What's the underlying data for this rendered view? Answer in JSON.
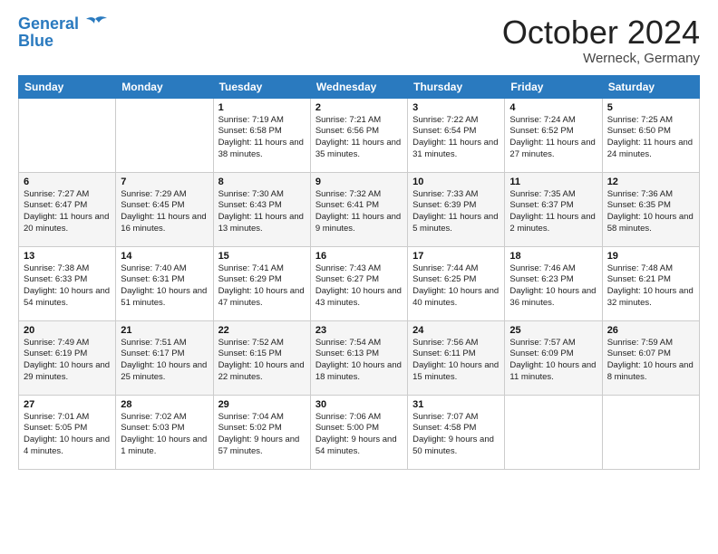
{
  "header": {
    "logo_line1": "General",
    "logo_line2": "Blue",
    "title": "October 2024",
    "location": "Werneck, Germany"
  },
  "days_of_week": [
    "Sunday",
    "Monday",
    "Tuesday",
    "Wednesday",
    "Thursday",
    "Friday",
    "Saturday"
  ],
  "weeks": [
    [
      {
        "day": "",
        "info": ""
      },
      {
        "day": "",
        "info": ""
      },
      {
        "day": "1",
        "sunrise": "Sunrise: 7:19 AM",
        "sunset": "Sunset: 6:58 PM",
        "daylight": "Daylight: 11 hours and 38 minutes."
      },
      {
        "day": "2",
        "sunrise": "Sunrise: 7:21 AM",
        "sunset": "Sunset: 6:56 PM",
        "daylight": "Daylight: 11 hours and 35 minutes."
      },
      {
        "day": "3",
        "sunrise": "Sunrise: 7:22 AM",
        "sunset": "Sunset: 6:54 PM",
        "daylight": "Daylight: 11 hours and 31 minutes."
      },
      {
        "day": "4",
        "sunrise": "Sunrise: 7:24 AM",
        "sunset": "Sunset: 6:52 PM",
        "daylight": "Daylight: 11 hours and 27 minutes."
      },
      {
        "day": "5",
        "sunrise": "Sunrise: 7:25 AM",
        "sunset": "Sunset: 6:50 PM",
        "daylight": "Daylight: 11 hours and 24 minutes."
      }
    ],
    [
      {
        "day": "6",
        "sunrise": "Sunrise: 7:27 AM",
        "sunset": "Sunset: 6:47 PM",
        "daylight": "Daylight: 11 hours and 20 minutes."
      },
      {
        "day": "7",
        "sunrise": "Sunrise: 7:29 AM",
        "sunset": "Sunset: 6:45 PM",
        "daylight": "Daylight: 11 hours and 16 minutes."
      },
      {
        "day": "8",
        "sunrise": "Sunrise: 7:30 AM",
        "sunset": "Sunset: 6:43 PM",
        "daylight": "Daylight: 11 hours and 13 minutes."
      },
      {
        "day": "9",
        "sunrise": "Sunrise: 7:32 AM",
        "sunset": "Sunset: 6:41 PM",
        "daylight": "Daylight: 11 hours and 9 minutes."
      },
      {
        "day": "10",
        "sunrise": "Sunrise: 7:33 AM",
        "sunset": "Sunset: 6:39 PM",
        "daylight": "Daylight: 11 hours and 5 minutes."
      },
      {
        "day": "11",
        "sunrise": "Sunrise: 7:35 AM",
        "sunset": "Sunset: 6:37 PM",
        "daylight": "Daylight: 11 hours and 2 minutes."
      },
      {
        "day": "12",
        "sunrise": "Sunrise: 7:36 AM",
        "sunset": "Sunset: 6:35 PM",
        "daylight": "Daylight: 10 hours and 58 minutes."
      }
    ],
    [
      {
        "day": "13",
        "sunrise": "Sunrise: 7:38 AM",
        "sunset": "Sunset: 6:33 PM",
        "daylight": "Daylight: 10 hours and 54 minutes."
      },
      {
        "day": "14",
        "sunrise": "Sunrise: 7:40 AM",
        "sunset": "Sunset: 6:31 PM",
        "daylight": "Daylight: 10 hours and 51 minutes."
      },
      {
        "day": "15",
        "sunrise": "Sunrise: 7:41 AM",
        "sunset": "Sunset: 6:29 PM",
        "daylight": "Daylight: 10 hours and 47 minutes."
      },
      {
        "day": "16",
        "sunrise": "Sunrise: 7:43 AM",
        "sunset": "Sunset: 6:27 PM",
        "daylight": "Daylight: 10 hours and 43 minutes."
      },
      {
        "day": "17",
        "sunrise": "Sunrise: 7:44 AM",
        "sunset": "Sunset: 6:25 PM",
        "daylight": "Daylight: 10 hours and 40 minutes."
      },
      {
        "day": "18",
        "sunrise": "Sunrise: 7:46 AM",
        "sunset": "Sunset: 6:23 PM",
        "daylight": "Daylight: 10 hours and 36 minutes."
      },
      {
        "day": "19",
        "sunrise": "Sunrise: 7:48 AM",
        "sunset": "Sunset: 6:21 PM",
        "daylight": "Daylight: 10 hours and 32 minutes."
      }
    ],
    [
      {
        "day": "20",
        "sunrise": "Sunrise: 7:49 AM",
        "sunset": "Sunset: 6:19 PM",
        "daylight": "Daylight: 10 hours and 29 minutes."
      },
      {
        "day": "21",
        "sunrise": "Sunrise: 7:51 AM",
        "sunset": "Sunset: 6:17 PM",
        "daylight": "Daylight: 10 hours and 25 minutes."
      },
      {
        "day": "22",
        "sunrise": "Sunrise: 7:52 AM",
        "sunset": "Sunset: 6:15 PM",
        "daylight": "Daylight: 10 hours and 22 minutes."
      },
      {
        "day": "23",
        "sunrise": "Sunrise: 7:54 AM",
        "sunset": "Sunset: 6:13 PM",
        "daylight": "Daylight: 10 hours and 18 minutes."
      },
      {
        "day": "24",
        "sunrise": "Sunrise: 7:56 AM",
        "sunset": "Sunset: 6:11 PM",
        "daylight": "Daylight: 10 hours and 15 minutes."
      },
      {
        "day": "25",
        "sunrise": "Sunrise: 7:57 AM",
        "sunset": "Sunset: 6:09 PM",
        "daylight": "Daylight: 10 hours and 11 minutes."
      },
      {
        "day": "26",
        "sunrise": "Sunrise: 7:59 AM",
        "sunset": "Sunset: 6:07 PM",
        "daylight": "Daylight: 10 hours and 8 minutes."
      }
    ],
    [
      {
        "day": "27",
        "sunrise": "Sunrise: 7:01 AM",
        "sunset": "Sunset: 5:05 PM",
        "daylight": "Daylight: 10 hours and 4 minutes."
      },
      {
        "day": "28",
        "sunrise": "Sunrise: 7:02 AM",
        "sunset": "Sunset: 5:03 PM",
        "daylight": "Daylight: 10 hours and 1 minute."
      },
      {
        "day": "29",
        "sunrise": "Sunrise: 7:04 AM",
        "sunset": "Sunset: 5:02 PM",
        "daylight": "Daylight: 9 hours and 57 minutes."
      },
      {
        "day": "30",
        "sunrise": "Sunrise: 7:06 AM",
        "sunset": "Sunset: 5:00 PM",
        "daylight": "Daylight: 9 hours and 54 minutes."
      },
      {
        "day": "31",
        "sunrise": "Sunrise: 7:07 AM",
        "sunset": "Sunset: 4:58 PM",
        "daylight": "Daylight: 9 hours and 50 minutes."
      },
      {
        "day": "",
        "info": ""
      },
      {
        "day": "",
        "info": ""
      }
    ]
  ]
}
